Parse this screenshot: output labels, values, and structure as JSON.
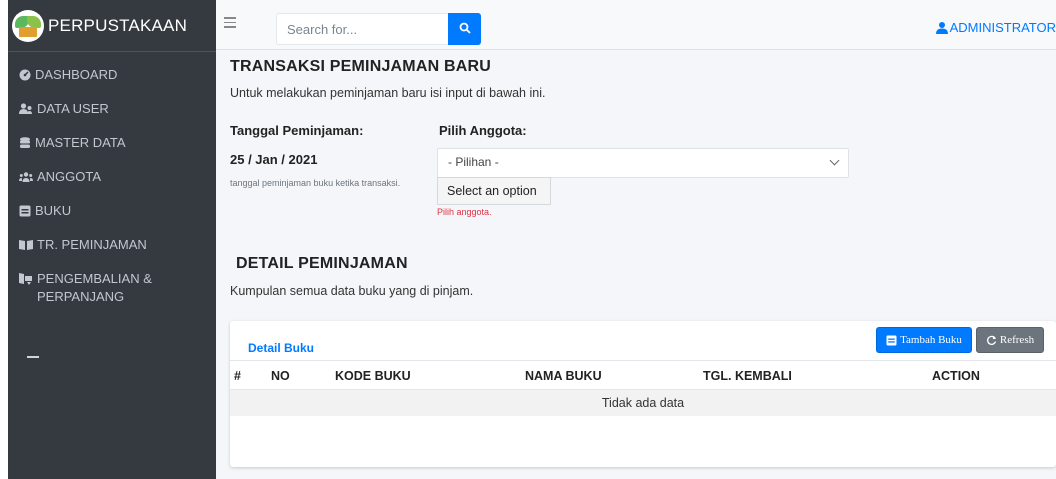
{
  "app": {
    "brand": "PERPUSTAKAAN"
  },
  "sidebar": {
    "items": [
      {
        "label": "DASHBOARD",
        "icon": "dashboard-icon"
      },
      {
        "label": "DATA USER",
        "icon": "users-icon"
      },
      {
        "label": "MASTER DATA",
        "icon": "database-icon"
      },
      {
        "label": "ANGGOTA",
        "icon": "users-group-icon"
      },
      {
        "label": "BUKU",
        "icon": "book-icon"
      },
      {
        "label": "TR. PEMINJAMAN",
        "icon": "book-open-icon"
      },
      {
        "label_line1": "PENGEMBALIAN &",
        "label_line2": "PERPANJANG",
        "icon": "return-icon"
      }
    ]
  },
  "topbar": {
    "search_placeholder": "Search for...",
    "user": "ADMINISTRATOR"
  },
  "page": {
    "title": "TRANSAKSI PEMINJAMAN BARU",
    "subtitle": "Untuk melakukan peminjaman baru isi input di bawah ini.",
    "tanggal_label": "Tanggal Peminjaman:",
    "tanggal_value": "25 / Jan / 2021",
    "tanggal_help": "tanggal peminjaman buku ketika transaksi.",
    "anggota_label": "Pilih Anggota:",
    "anggota_selected": "- Pilihan -",
    "anggota_option": "Select an option",
    "anggota_error": "Pilih anggota."
  },
  "detail": {
    "title": "DETAIL PEMINJAMAN",
    "subtitle": "Kumpulan semua data buku yang di pinjam.",
    "card_title": "Detail Buku",
    "tambah_label": "Tambah Buku",
    "refresh_label": "Refresh",
    "columns": [
      "#",
      "NO",
      "KODE BUKU",
      "NAMA BUKU",
      "TGL. KEMBALI",
      "ACTION"
    ],
    "empty_text": "Tidak ada data"
  },
  "colors": {
    "primary": "#007bff",
    "sidebar": "#343a40",
    "danger": "#dc3545",
    "secondary": "#6c757d"
  }
}
